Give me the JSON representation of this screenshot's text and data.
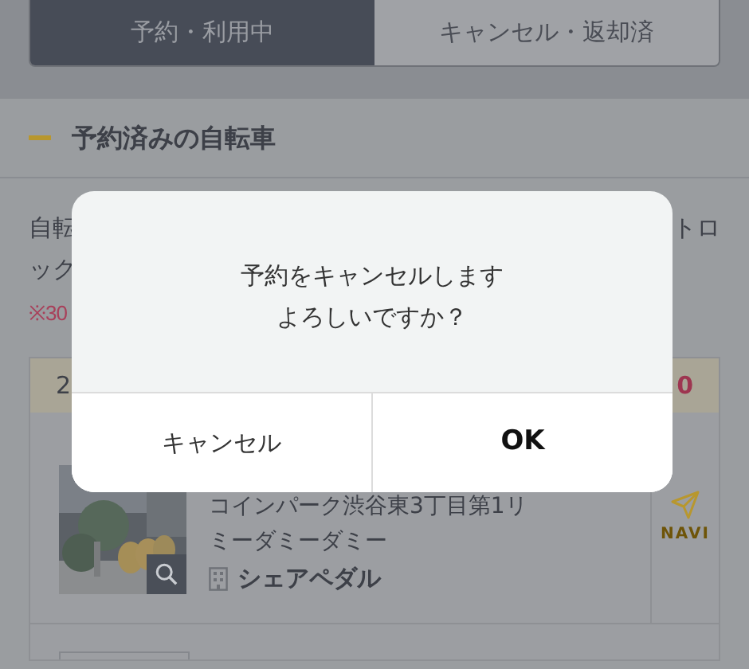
{
  "tabs": [
    {
      "label": "予約・利用中",
      "selected": true
    },
    {
      "label": "キャンセル・返却済",
      "selected": false
    }
  ],
  "section": {
    "title": "予約済みの自転車"
  },
  "notice": {
    "line_1_start": "自転",
    "line_1_end": "トロ",
    "line_2_start": "ック",
    "warning_start": "※30"
  },
  "card": {
    "header_start": "2",
    "header_end": "0",
    "address_lines": [
      "コインパーク渋谷東3丁目第1リ",
      "ミーダミーダミー"
    ],
    "operator": "シェアペダル",
    "navi_label": "NAVI"
  },
  "dialog": {
    "message_lines": [
      "予約をキャンセルします",
      "よろしいですか？"
    ],
    "buttons": [
      {
        "label": "キャンセル",
        "kind": "cancel"
      },
      {
        "label": "OK",
        "kind": "confirm"
      }
    ]
  }
}
